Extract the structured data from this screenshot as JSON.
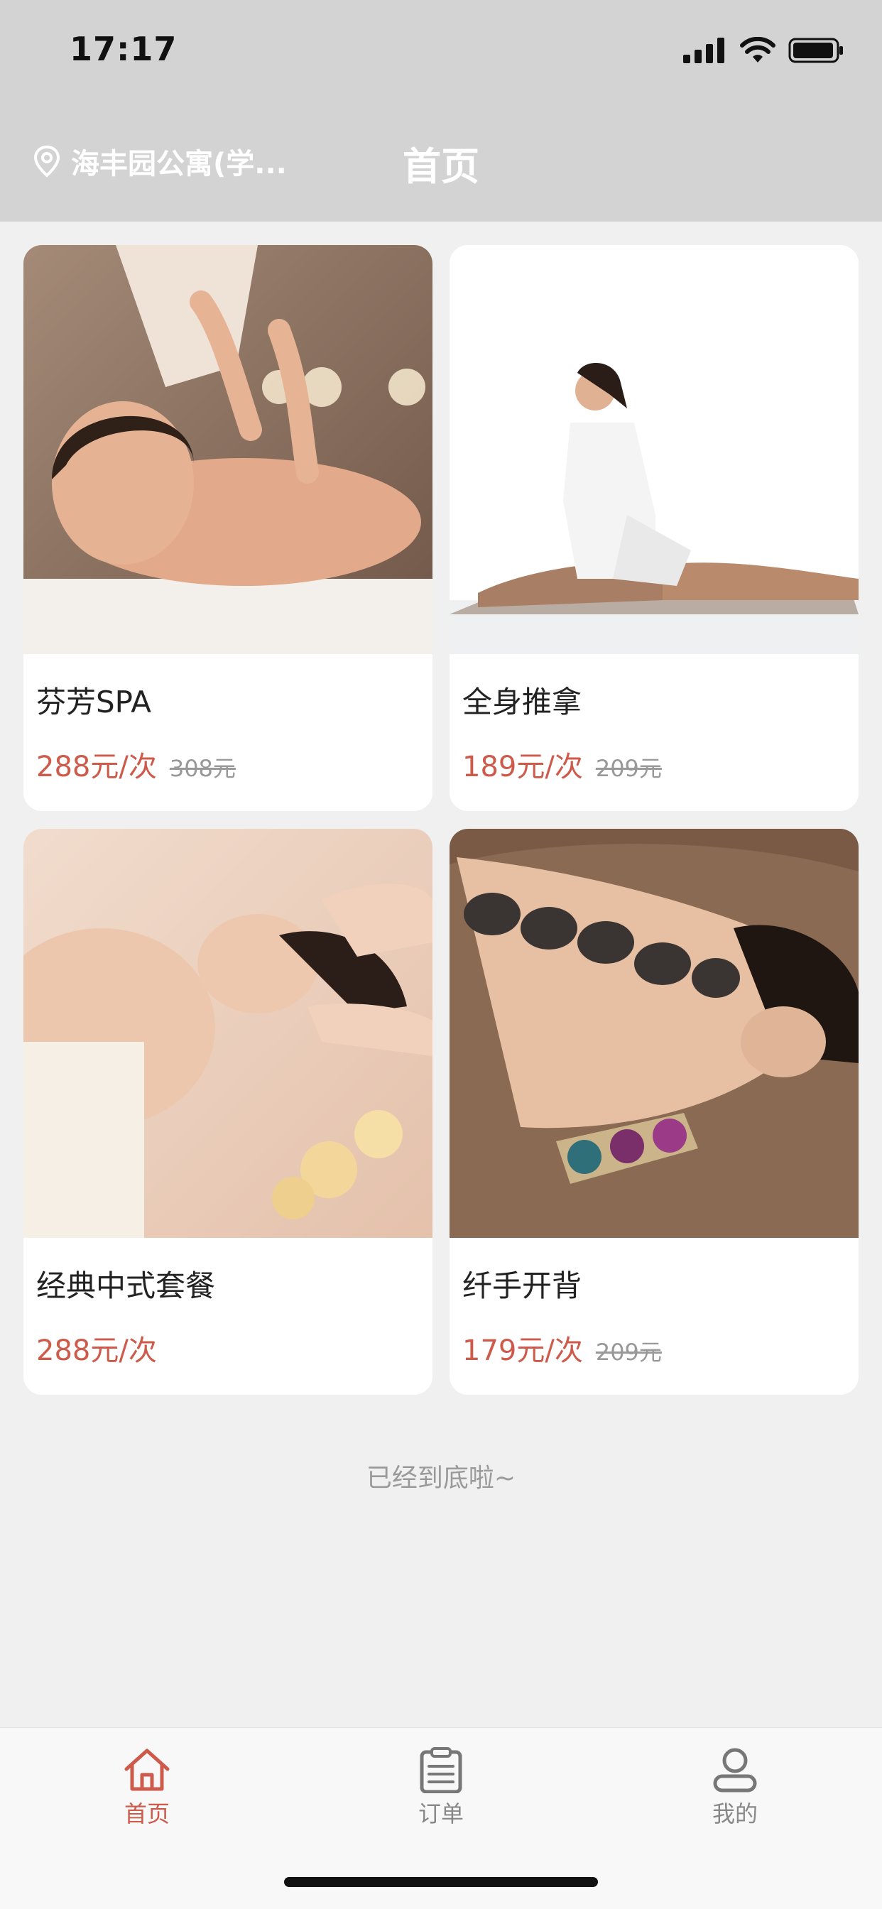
{
  "status_bar": {
    "time": "17:17"
  },
  "header": {
    "location": "海丰园公寓(学...",
    "title": "首页"
  },
  "products": [
    {
      "name": "芬芳SPA",
      "price": "288元/次",
      "original_price": "308元"
    },
    {
      "name": "全身推拿",
      "price": "189元/次",
      "original_price": "209元"
    },
    {
      "name": "经典中式套餐",
      "price": "288元/次",
      "original_price": ""
    },
    {
      "name": "纤手开背",
      "price": "179元/次",
      "original_price": "209元"
    }
  ],
  "list_end_text": "已经到底啦~",
  "tabbar": {
    "items": [
      {
        "label": "首页",
        "icon": "home-icon",
        "active": true
      },
      {
        "label": "订单",
        "icon": "clipboard-icon",
        "active": false
      },
      {
        "label": "我的",
        "icon": "user-icon",
        "active": false
      }
    ]
  },
  "colors": {
    "accent": "#cd5a4a",
    "header_bg": "#d3d3d3",
    "page_bg": "#f0f0f0",
    "muted_text": "#9a9a9a"
  }
}
